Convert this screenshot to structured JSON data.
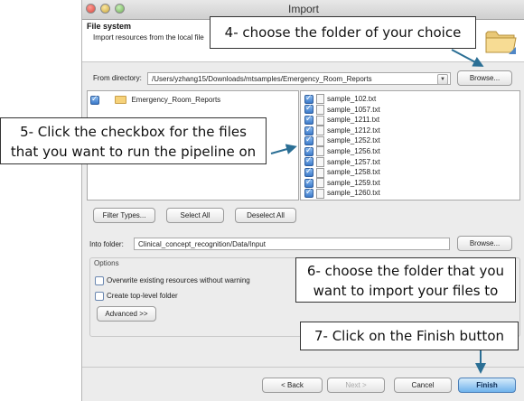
{
  "window": {
    "title": "Import"
  },
  "header": {
    "title": "File system",
    "description": "Import resources from the local file"
  },
  "from_directory": {
    "label": "From directory:",
    "value": "/Users/yzhang15/Downloads/mtsamples/Emergency_Room_Reports",
    "browse_label": "Browse..."
  },
  "tree": {
    "items": [
      {
        "label": "Emergency_Room_Reports"
      }
    ]
  },
  "files": [
    "sample_102.txt",
    "sample_1057.txt",
    "sample_1211.txt",
    "sample_1212.txt",
    "sample_1252.txt",
    "sample_1256.txt",
    "sample_1257.txt",
    "sample_1258.txt",
    "sample_1259.txt",
    "sample_1260.txt"
  ],
  "buttons": {
    "filter_types": "Filter Types...",
    "select_all": "Select All",
    "deselect_all": "Deselect All"
  },
  "into_folder": {
    "label": "Into folder:",
    "value": "Clinical_concept_recognition/Data/Input",
    "browse_label": "Browse..."
  },
  "options": {
    "title": "Options",
    "overwrite": "Overwrite existing resources without warning",
    "create_top_level": "Create top-level folder",
    "advanced": "Advanced >>"
  },
  "footer": {
    "back": "< Back",
    "next": "Next >",
    "cancel": "Cancel",
    "finish": "Finish"
  },
  "annotations": {
    "a4": "4- choose the folder of your choice",
    "a5_line1": "5- Click the checkbox for the files",
    "a5_line2": "that you want to run the pipeline on",
    "a6_line1": "6- choose the folder that you",
    "a6_line2": "want to import your  files to",
    "a7": "7- Click on the Finish button"
  },
  "colors": {
    "arrow": "#2b6f95",
    "primary_button": "#6fb2ec",
    "folder": "#f6d27a"
  }
}
